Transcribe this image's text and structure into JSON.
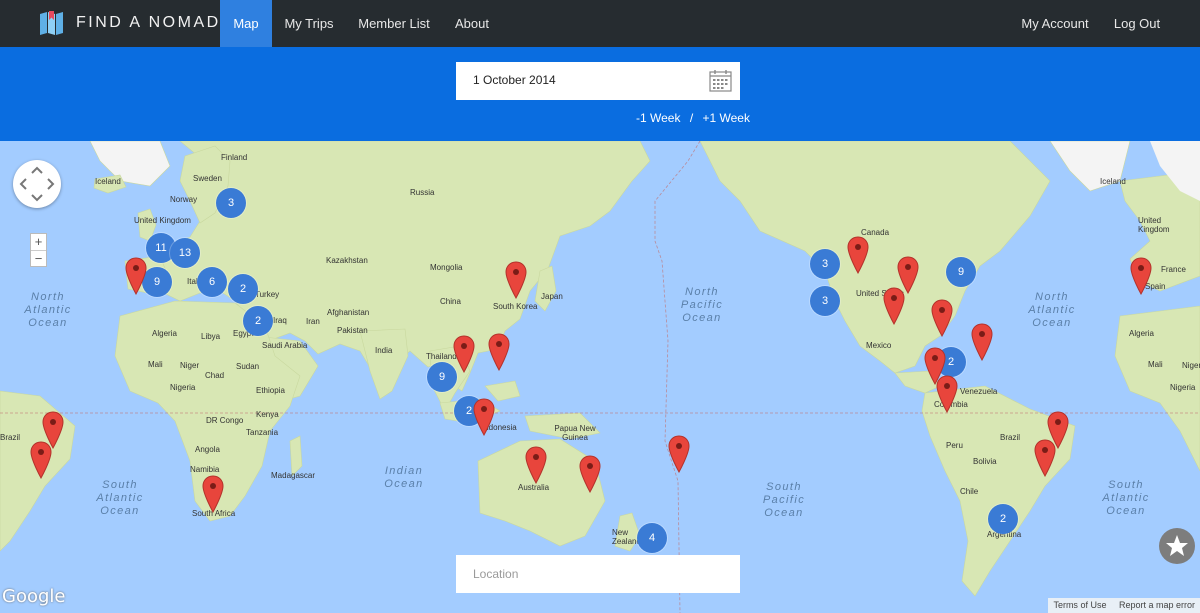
{
  "header": {
    "brand": "FIND A NOMAD",
    "nav": [
      "Map",
      "My Trips",
      "Member List",
      "About"
    ],
    "active": "Map",
    "right_nav": [
      "My Account",
      "Log Out"
    ]
  },
  "filters": {
    "date_value": "1 October 2014",
    "prev_week": "-1 Week",
    "separator": "/",
    "next_week": "+1 Week",
    "location_placeholder": "Location"
  },
  "map": {
    "oceans": [
      {
        "text": "North Atlantic Ocean",
        "lines": [
          "North",
          "Atlantic",
          "Ocean"
        ]
      },
      {
        "text": "North Pacific Ocean",
        "lines": [
          "North",
          "Pacific",
          "Ocean"
        ]
      },
      {
        "text": "North Atlantic Ocean",
        "lines": [
          "North",
          "Atlantic",
          "Ocean"
        ]
      },
      {
        "text": "South Atlantic Ocean",
        "lines": [
          "South",
          "Atlantic",
          "Ocean"
        ]
      },
      {
        "text": "Indian Ocean",
        "lines": [
          "Indian",
          "Ocean"
        ]
      },
      {
        "text": "South Pacific Ocean",
        "lines": [
          "South",
          "Pacific",
          "Ocean"
        ]
      },
      {
        "text": "South Atlantic Ocean",
        "lines": [
          "South",
          "Atlantic",
          "Ocean"
        ]
      }
    ],
    "place_labels": [
      "Finland",
      "Sweden",
      "Norway",
      "Iceland",
      "United Kingdom",
      "Russia",
      "Kazakhstan",
      "Mongolia",
      "China",
      "Japan",
      "South Korea",
      "Afghanistan",
      "Pakistan",
      "India",
      "Iran",
      "Iraq",
      "Turkey",
      "Saudi Arabia",
      "Egypt",
      "Libya",
      "Algeria",
      "Mali",
      "Niger",
      "Chad",
      "Sudan",
      "Nigeria",
      "Ethiopia",
      "Kenya",
      "DR Congo",
      "Tanzania",
      "Angola",
      "Namibia",
      "Madagascar",
      "South Africa",
      "Thailand",
      "Indonesia",
      "Papua New Guinea",
      "Australia",
      "New Zealand",
      "Canada",
      "United States",
      "Mexico",
      "Venezuela",
      "Colombia",
      "Peru",
      "Brazil",
      "Bolivia",
      "Chile",
      "Argentina",
      "Iceland",
      "United Kingdom",
      "France",
      "Spain",
      "Algeria",
      "Mali",
      "Niger",
      "Brazil",
      "Italy",
      "Nigeria"
    ],
    "clusters": [
      "3",
      "11",
      "13",
      "9",
      "6",
      "2",
      "2",
      "9",
      "2",
      "3",
      "3",
      "9",
      "2",
      "4",
      "2"
    ],
    "pins": [
      "Portugal",
      "South Korea",
      "Thailand",
      "Philippines",
      "Indonesia",
      "Australia",
      "Australia East",
      "Fiji",
      "Canada",
      "United States",
      "US West",
      "US East",
      "Caribbean",
      "Central America",
      "Colombia",
      "Brazil NE",
      "Brazil SE",
      "Brazil W",
      "Brazil S",
      "South Africa",
      "Spain"
    ],
    "zoom_in": "+",
    "zoom_out": "−",
    "google": "Google",
    "terms": "Terms of Use",
    "report": "Report a map error"
  },
  "colors": {
    "nav_bg": "#262c30",
    "accent": "#0a6de0",
    "active_tab": "#2f80e0",
    "cluster": "#3a7bd5",
    "pin": "#e8453c",
    "water": "#a3ccff",
    "land": "#d8e7b4"
  }
}
